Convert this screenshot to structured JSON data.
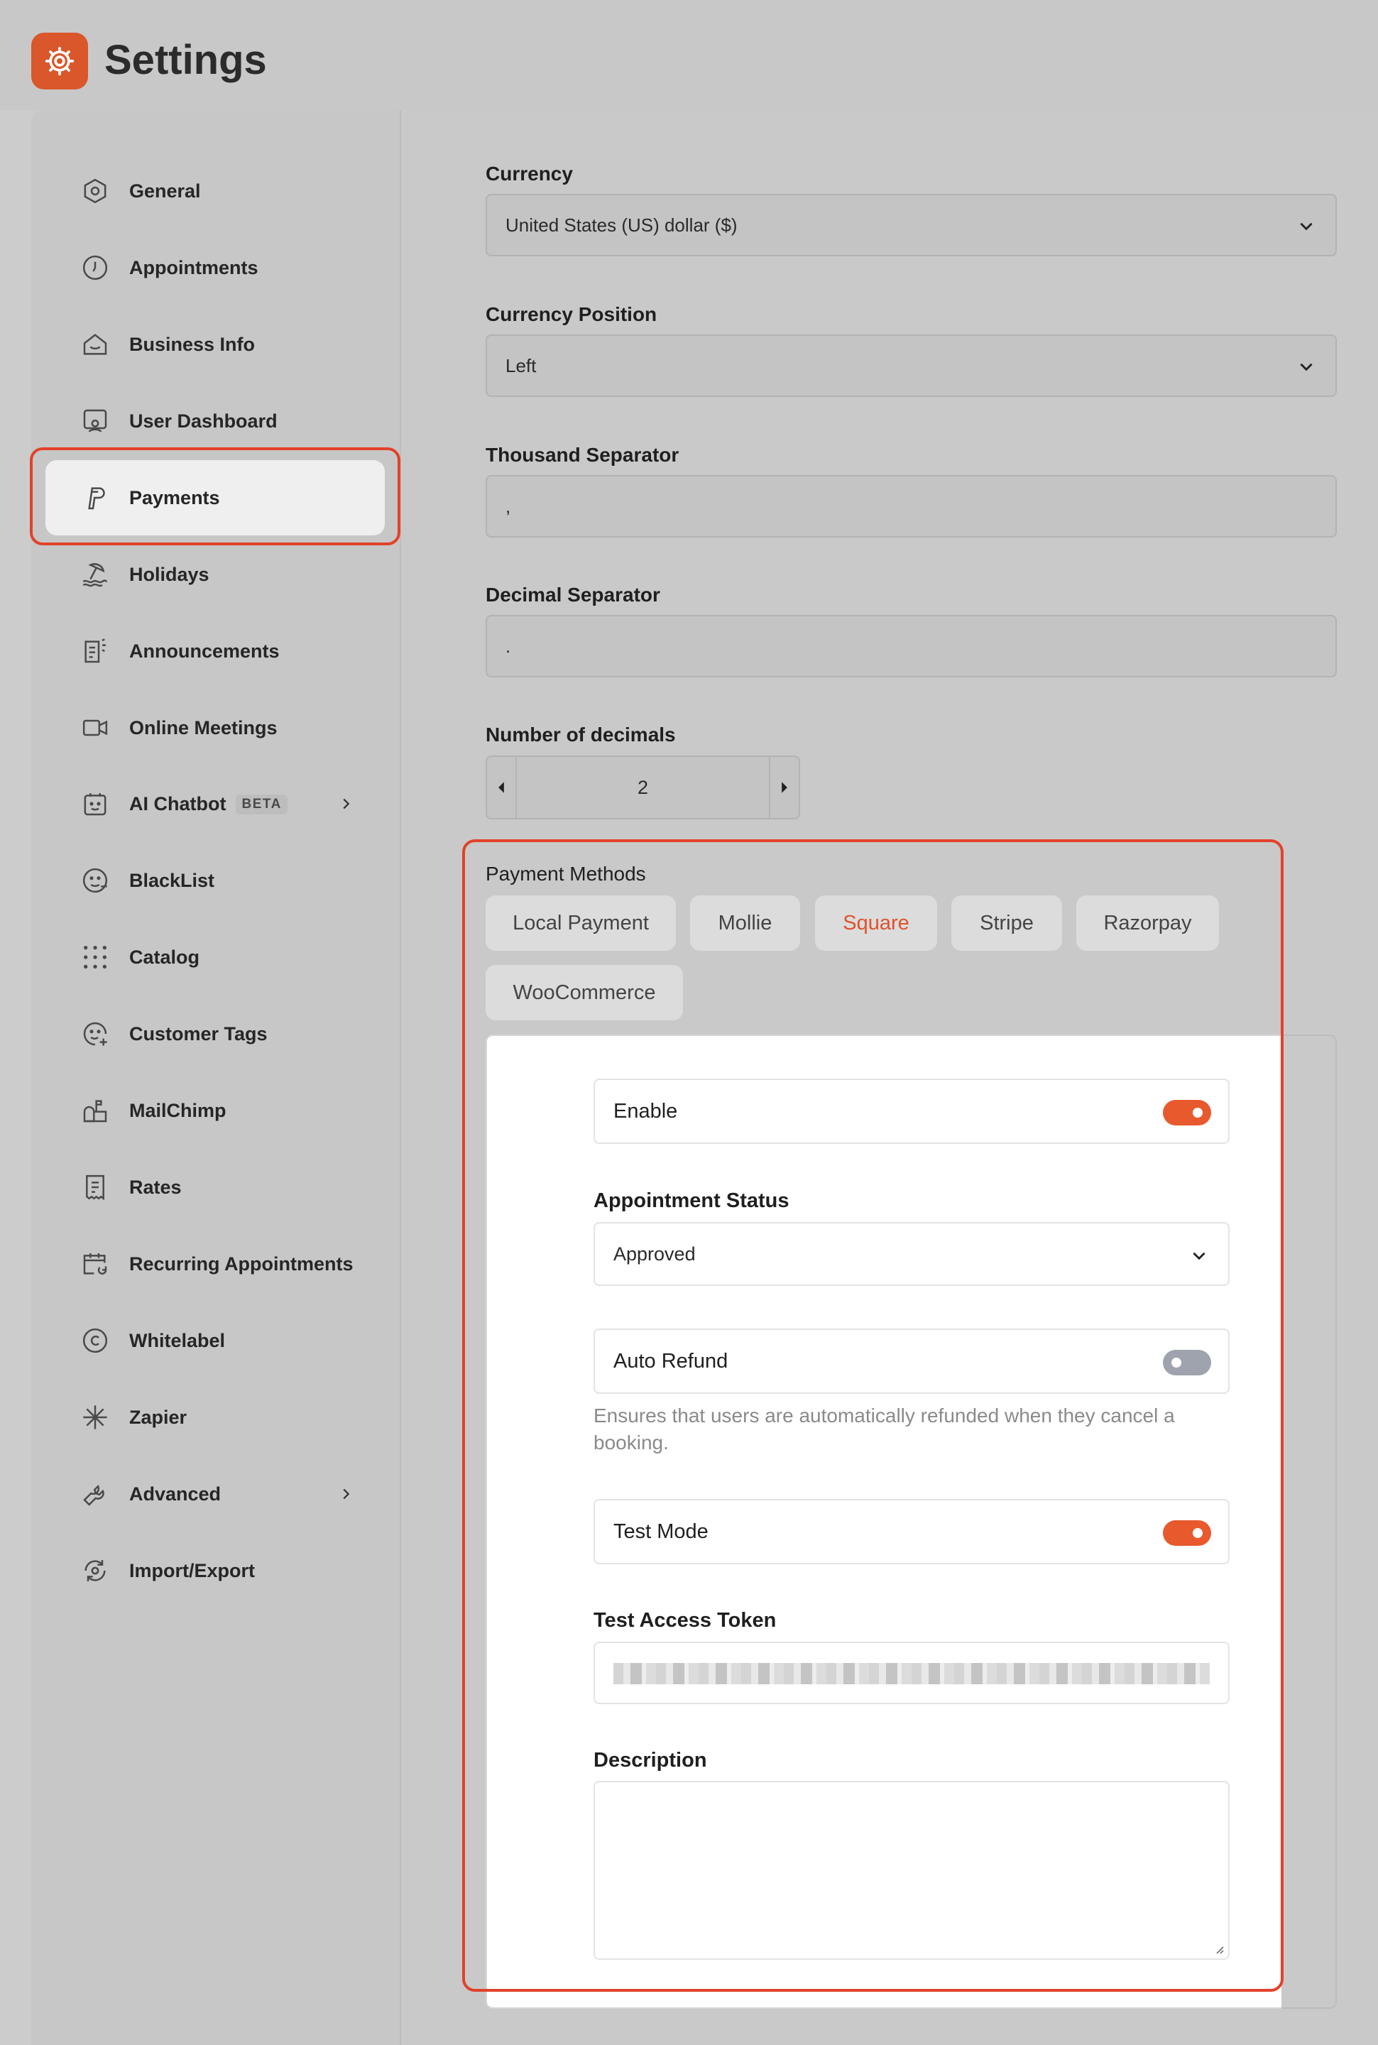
{
  "header": {
    "title": "Settings",
    "logo_icon": "gear-icon"
  },
  "sidebar": {
    "items": [
      {
        "label": "General",
        "icon": "hexagon-icon"
      },
      {
        "label": "Appointments",
        "icon": "clock-icon"
      },
      {
        "label": "Business Info",
        "icon": "home-icon"
      },
      {
        "label": "User Dashboard",
        "icon": "user-screen-icon"
      },
      {
        "label": "Payments",
        "icon": "paypal-icon",
        "active": true
      },
      {
        "label": "Holidays",
        "icon": "beach-icon"
      },
      {
        "label": "Announcements",
        "icon": "announcement-icon"
      },
      {
        "label": "Online Meetings",
        "icon": "video-icon"
      },
      {
        "label": "AI Chatbot",
        "icon": "bot-icon",
        "badge": "BETA",
        "has_submenu": true
      },
      {
        "label": "BlackList",
        "icon": "face-icon"
      },
      {
        "label": "Catalog",
        "icon": "grid-dots-icon"
      },
      {
        "label": "Customer Tags",
        "icon": "face-plus-icon"
      },
      {
        "label": "MailChimp",
        "icon": "mailbox-icon"
      },
      {
        "label": "Rates",
        "icon": "receipt-icon"
      },
      {
        "label": "Recurring Appointments",
        "icon": "calendar-repeat-icon"
      },
      {
        "label": "Whitelabel",
        "icon": "copyright-icon"
      },
      {
        "label": "Zapier",
        "icon": "asterisk-icon"
      },
      {
        "label": "Advanced",
        "icon": "wrench-icon",
        "has_submenu": true
      },
      {
        "label": "Import/Export",
        "icon": "sync-icon"
      }
    ]
  },
  "form": {
    "currency": {
      "label": "Currency",
      "value": "United States (US) dollar ($)"
    },
    "currency_position": {
      "label": "Currency Position",
      "value": "Left"
    },
    "thousand_separator": {
      "label": "Thousand Separator",
      "value": ","
    },
    "decimal_separator": {
      "label": "Decimal Separator",
      "value": "."
    },
    "decimals": {
      "label": "Number of decimals",
      "value": "2"
    }
  },
  "payment_methods": {
    "label": "Payment Methods",
    "tabs": [
      {
        "label": "Local Payment"
      },
      {
        "label": "Mollie"
      },
      {
        "label": "Square",
        "active": true
      },
      {
        "label": "Stripe"
      },
      {
        "label": "Razorpay"
      },
      {
        "label": "WooCommerce"
      }
    ],
    "square": {
      "enable": {
        "label": "Enable",
        "on": true
      },
      "appointment_status": {
        "label": "Appointment Status",
        "value": "Approved"
      },
      "auto_refund": {
        "label": "Auto Refund",
        "on": false,
        "help": "Ensures that users are automatically refunded when they cancel a booking."
      },
      "test_mode": {
        "label": "Test Mode",
        "on": true
      },
      "test_access_token": {
        "label": "Test Access Token"
      },
      "description": {
        "label": "Description",
        "value": ""
      }
    }
  },
  "colors": {
    "accent": "#e8592e",
    "highlight": "#e2422a"
  }
}
